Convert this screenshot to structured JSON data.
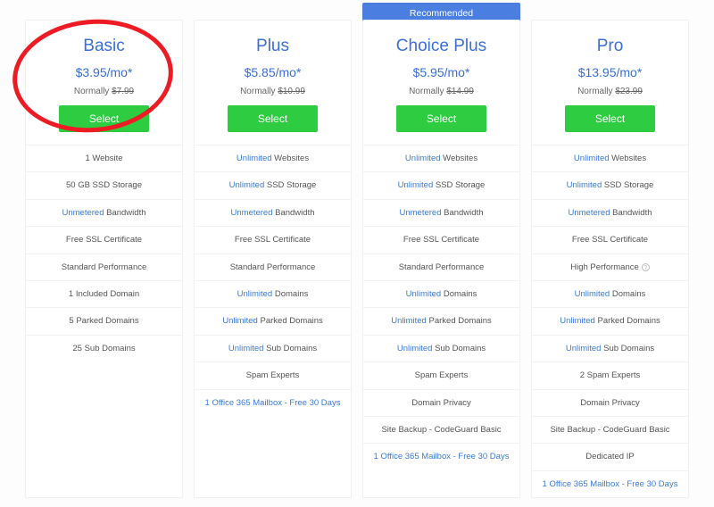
{
  "recommended_label": "Recommended",
  "normal_prefix": "Normally ",
  "select_label": "Select",
  "plans": [
    {
      "name": "Basic",
      "price": "$3.95/mo*",
      "normal": "$7.99",
      "recommended": false,
      "features": [
        [
          {
            "t": "1 Website"
          }
        ],
        [
          {
            "t": "50 GB SSD Storage"
          }
        ],
        [
          {
            "t": "Unmetered",
            "hl": true
          },
          {
            "t": " Bandwidth"
          }
        ],
        [
          {
            "t": "Free SSL Certificate"
          }
        ],
        [
          {
            "t": "Standard Performance"
          }
        ],
        [
          {
            "t": "1 Included Domain"
          }
        ],
        [
          {
            "t": "5 Parked Domains"
          }
        ],
        [
          {
            "t": "25 Sub Domains"
          }
        ]
      ]
    },
    {
      "name": "Plus",
      "price": "$5.85/mo*",
      "normal": "$10.99",
      "recommended": false,
      "features": [
        [
          {
            "t": "Unlimited",
            "hl": true
          },
          {
            "t": " Websites"
          }
        ],
        [
          {
            "t": "Unlimited",
            "hl": true
          },
          {
            "t": " SSD Storage"
          }
        ],
        [
          {
            "t": "Unmetered",
            "hl": true
          },
          {
            "t": " Bandwidth"
          }
        ],
        [
          {
            "t": "Free SSL Certificate"
          }
        ],
        [
          {
            "t": "Standard Performance"
          }
        ],
        [
          {
            "t": "Unlimited",
            "hl": true
          },
          {
            "t": " Domains"
          }
        ],
        [
          {
            "t": "Unlimited",
            "hl": true
          },
          {
            "t": " Parked Domains"
          }
        ],
        [
          {
            "t": "Unlimited",
            "hl": true
          },
          {
            "t": " Sub Domains"
          }
        ],
        [
          {
            "t": "Spam Experts"
          }
        ],
        [
          {
            "t": "1 Office 365 Mailbox - Free 30 Days",
            "hl": true
          }
        ]
      ]
    },
    {
      "name": "Choice Plus",
      "price": "$5.95/mo*",
      "normal": "$14.99",
      "recommended": true,
      "features": [
        [
          {
            "t": "Unlimited",
            "hl": true
          },
          {
            "t": " Websites"
          }
        ],
        [
          {
            "t": "Unlimited",
            "hl": true
          },
          {
            "t": " SSD Storage"
          }
        ],
        [
          {
            "t": "Unmetered",
            "hl": true
          },
          {
            "t": " Bandwidth"
          }
        ],
        [
          {
            "t": "Free SSL Certificate"
          }
        ],
        [
          {
            "t": "Standard Performance"
          }
        ],
        [
          {
            "t": "Unlimited",
            "hl": true
          },
          {
            "t": " Domains"
          }
        ],
        [
          {
            "t": "Unlimited",
            "hl": true
          },
          {
            "t": " Parked Domains"
          }
        ],
        [
          {
            "t": "Unlimited",
            "hl": true
          },
          {
            "t": " Sub Domains"
          }
        ],
        [
          {
            "t": "Spam Experts"
          }
        ],
        [
          {
            "t": "Domain Privacy"
          }
        ],
        [
          {
            "t": "Site Backup - CodeGuard Basic"
          }
        ],
        [
          {
            "t": "1 Office 365 Mailbox - Free 30 Days",
            "hl": true
          }
        ]
      ]
    },
    {
      "name": "Pro",
      "price": "$13.95/mo*",
      "normal": "$23.99",
      "recommended": false,
      "features": [
        [
          {
            "t": "Unlimited",
            "hl": true
          },
          {
            "t": " Websites"
          }
        ],
        [
          {
            "t": "Unlimited",
            "hl": true
          },
          {
            "t": " SSD Storage"
          }
        ],
        [
          {
            "t": "Unmetered",
            "hl": true
          },
          {
            "t": " Bandwidth"
          }
        ],
        [
          {
            "t": "Free SSL Certificate"
          }
        ],
        [
          {
            "t": "High Performance"
          },
          {
            "t": " ",
            "info": true
          }
        ],
        [
          {
            "t": "Unlimited",
            "hl": true
          },
          {
            "t": " Domains"
          }
        ],
        [
          {
            "t": "Unlimited",
            "hl": true
          },
          {
            "t": " Parked Domains"
          }
        ],
        [
          {
            "t": "Unlimited",
            "hl": true
          },
          {
            "t": " Sub Domains"
          }
        ],
        [
          {
            "t": "2 Spam Experts"
          }
        ],
        [
          {
            "t": "Domain Privacy"
          }
        ],
        [
          {
            "t": "Site Backup - CodeGuard Basic"
          }
        ],
        [
          {
            "t": "Dedicated IP"
          }
        ],
        [
          {
            "t": "1 Office 365 Mailbox - Free 30 Days",
            "hl": true
          }
        ]
      ]
    }
  ]
}
